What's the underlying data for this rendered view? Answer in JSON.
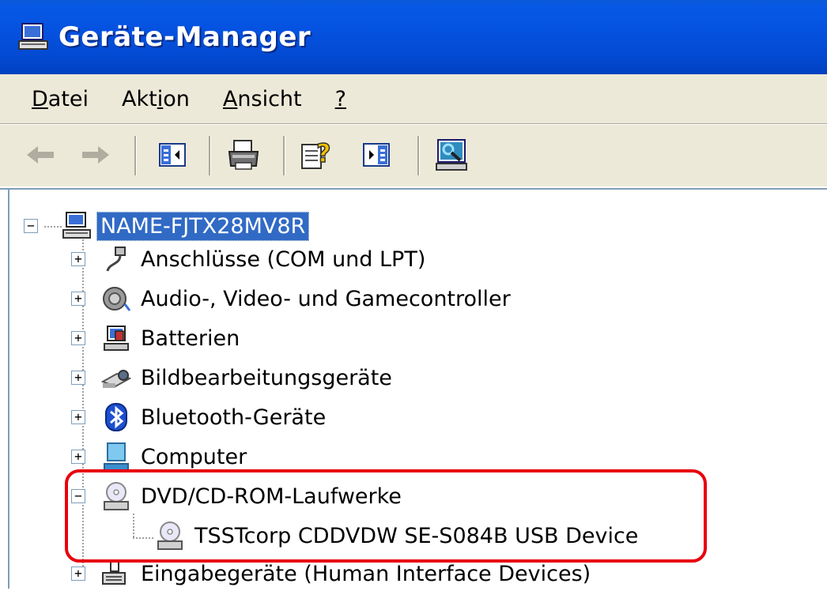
{
  "window": {
    "title": "Geräte-Manager"
  },
  "menu": [
    {
      "id": "datei",
      "u": "D",
      "rest": "atei"
    },
    {
      "id": "aktion",
      "pre": "Akt",
      "u": "i",
      "rest": "on"
    },
    {
      "id": "ansicht",
      "u": "A",
      "rest": "nsicht"
    },
    {
      "id": "help",
      "u": "?",
      "rest": ""
    }
  ],
  "toolbar": {
    "back": "back-arrow-icon",
    "forward": "forward-arrow-icon",
    "show_hide_tree": "console-tree-icon",
    "print": "printer-icon",
    "help": "help-icon",
    "properties": "properties-pane-icon",
    "scan": "scan-hardware-icon"
  },
  "tree": {
    "root": "NAME-FJTX28MV8R",
    "items": [
      {
        "label": "Anschlüsse (COM und LPT)",
        "expander": "+"
      },
      {
        "label": "Audio-, Video- und Gamecontroller",
        "expander": "+"
      },
      {
        "label": "Batterien",
        "expander": "+"
      },
      {
        "label": "Bildbearbeitungsgeräte",
        "expander": "+"
      },
      {
        "label": "Bluetooth-Geräte",
        "expander": "+"
      },
      {
        "label": "Computer",
        "expander": "+"
      },
      {
        "label": "DVD/CD-ROM-Laufwerke",
        "expander": "−"
      },
      {
        "label": "Eingabegeräte (Human Interface Devices)",
        "expander": "+"
      }
    ],
    "dvd_child": "TSSTcorp CDDVDW SE-S084B USB Device"
  },
  "colors": {
    "titlebar": "#0552e0",
    "chrome": "#ece9d8",
    "selection": "#316ac5",
    "highlight": "#e8000d"
  }
}
